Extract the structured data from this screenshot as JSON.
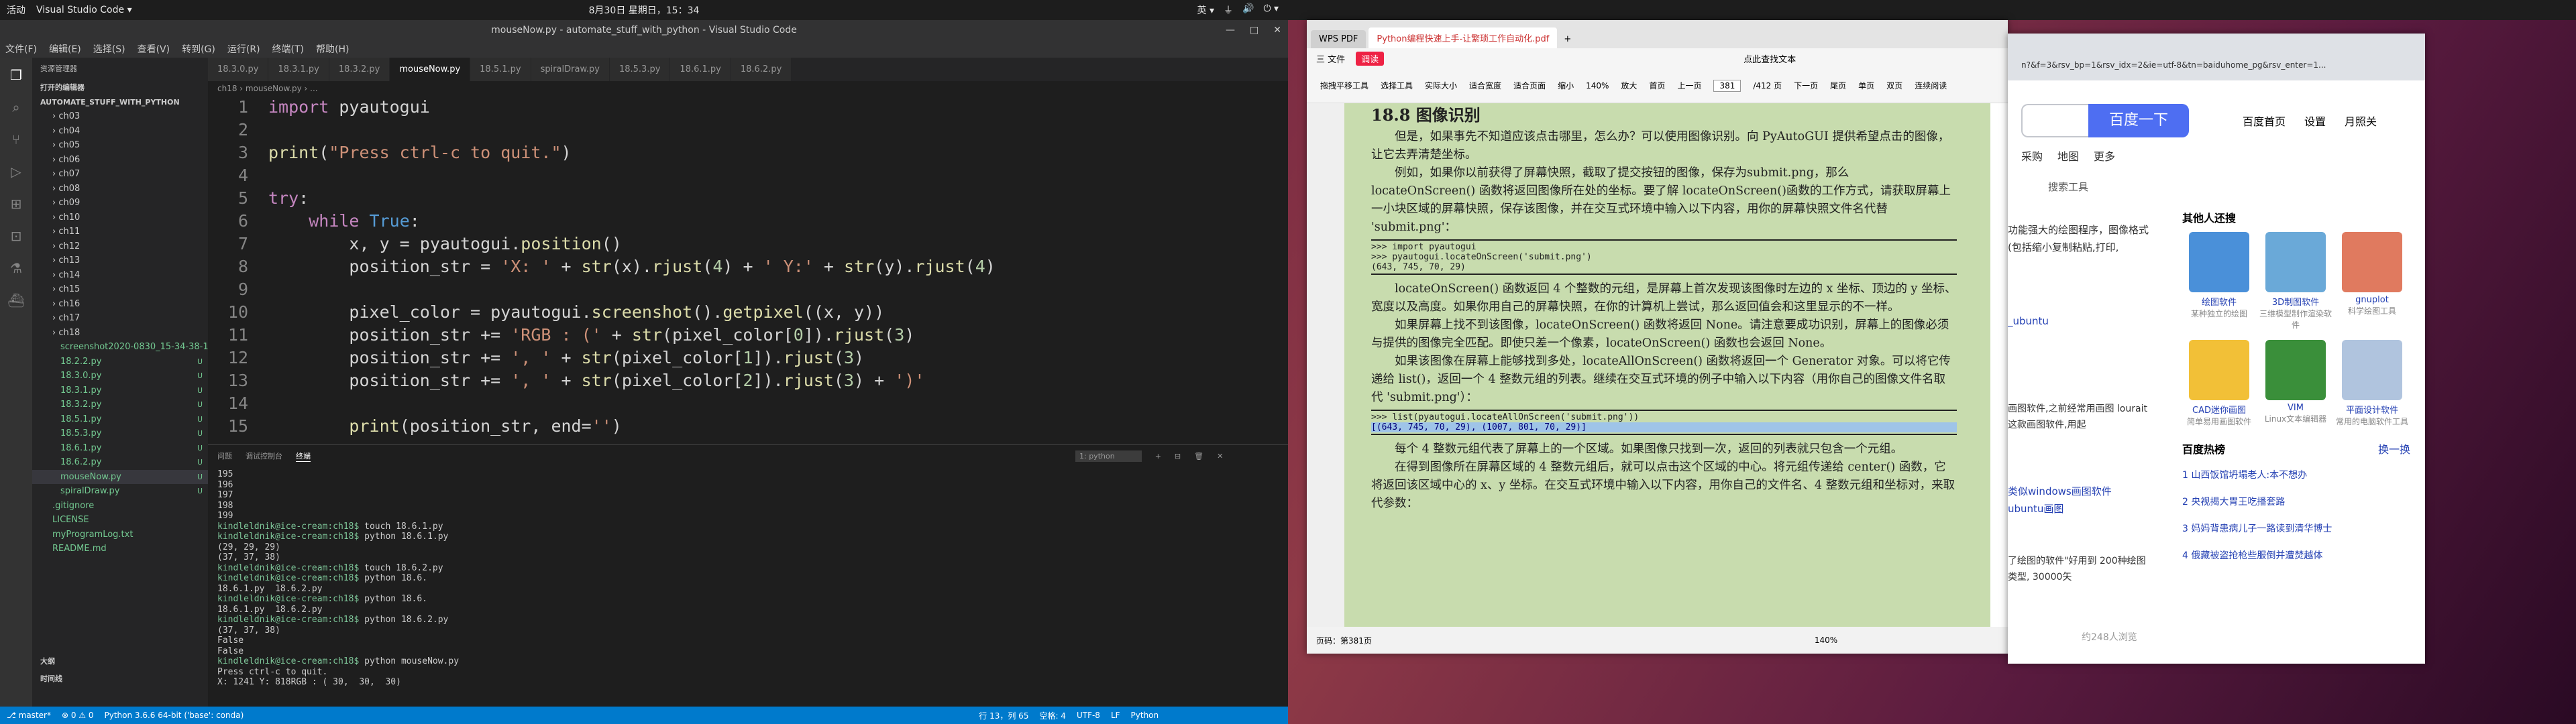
{
  "topbar": {
    "activities": "活动",
    "app": "Visual Studio Code ▾",
    "clock": "8月30日 星期日，15：34",
    "lang": "英 ▾"
  },
  "vscode": {
    "title": "mouseNow.py - automate_stuff_with_python - Visual Studio Code",
    "menu": [
      "文件(F)",
      "编辑(E)",
      "选择(S)",
      "查看(V)",
      "转到(G)",
      "运行(R)",
      "终端(T)",
      "帮助(H)"
    ],
    "side_header": "资源管理器",
    "open_editors": "打开的编辑器",
    "project": "AUTOMATE_STUFF_WITH_PYTHON",
    "tree": [
      "ch03",
      "ch04",
      "ch05",
      "ch06",
      "ch07",
      "ch08",
      "ch09",
      "ch10",
      "ch11",
      "ch12",
      "ch13",
      "ch14",
      "ch15",
      "ch16",
      "ch17",
      "ch18"
    ],
    "files": [
      {
        "name": "screenshot2020-0830_15-34-38-1...",
        "badge": "U"
      },
      {
        "name": "18.2.2.py",
        "badge": "U"
      },
      {
        "name": "18.3.0.py",
        "badge": "U"
      },
      {
        "name": "18.3.1.py",
        "badge": "U"
      },
      {
        "name": "18.3.2.py",
        "badge": "U"
      },
      {
        "name": "18.5.1.py",
        "badge": "U"
      },
      {
        "name": "18.5.3.py",
        "badge": "U"
      },
      {
        "name": "18.6.1.py",
        "badge": "U"
      },
      {
        "name": "18.6.2.py",
        "badge": "U"
      },
      {
        "name": "mouseNow.py",
        "badge": "U"
      },
      {
        "name": "spiralDraw.py",
        "badge": "U"
      },
      {
        "name": ".gitignore",
        "badge": ""
      },
      {
        "name": "LICENSE",
        "badge": ""
      },
      {
        "name": "myProgramLog.txt",
        "badge": ""
      },
      {
        "name": "README.md",
        "badge": ""
      }
    ],
    "outline": "大纲",
    "timeline": "时间线",
    "tabs": [
      "18.3.0.py",
      "18.3.1.py",
      "18.3.2.py",
      "mouseNow.py",
      "18.5.1.py",
      "spiralDraw.py",
      "18.5.3.py",
      "18.6.1.py",
      "18.6.2.py"
    ],
    "breadcrumb": "ch18 › mouseNow.py › ...",
    "code": [
      "import pyautogui",
      "",
      "print(\"Press ctrl-c to quit.\")",
      "",
      "try:",
      "    while True:",
      "        x, y = pyautogui.position()",
      "        position_str = 'X: ' + str(x).rjust(4) + ' Y:' + str(y).rjust(4)",
      "",
      "        pixel_color = pyautogui.screenshot().getpixel((x, y))",
      "        position_str += 'RGB : (' + str(pixel_color[0]).rjust(3)",
      "        position_str += ', ' + str(pixel_color[1]).rjust(3)",
      "        position_str += ', ' + str(pixel_color[2]).rjust(3) + ')'",
      "",
      "        print(position_str, end='')"
    ],
    "panel_tabs": [
      "问题",
      "调试控制台",
      "终端"
    ],
    "terminal_select": "1: python",
    "terminal": [
      "195",
      "196",
      "197",
      "198",
      "199",
      "kindleldnik@ice-cream:ch18$ touch 18.6.1.py",
      "kindleldnik@ice-cream:ch18$ python 18.6.1.py",
      "(29, 29, 29)",
      "(37, 37, 38)",
      "kindleldnik@ice-cream:ch18$ touch 18.6.2.py",
      "kindleldnik@ice-cream:ch18$ python 18.6.",
      "18.6.1.py  18.6.2.py",
      "kindleldnik@ice-cream:ch18$ python 18.6.",
      "18.6.1.py  18.6.2.py",
      "kindleldnik@ice-cream:ch18$ python 18.6.2.py",
      "(37, 37, 38)",
      "False",
      "False",
      "kindleldnik@ice-cream:ch18$ python mouseNow.py",
      "Press ctrl-c to quit.",
      "X: 1241 Y: 818RGB : ( 30,  30,  30)"
    ],
    "status": [
      "⎇ master*",
      "⊗ 0 ⚠ 0",
      "Python 3.6.6 64-bit ('base': conda)",
      "行 13，列 65",
      "空格: 4",
      "UTF-8",
      "LF",
      "Python"
    ]
  },
  "wps": {
    "tabs": [
      "WPS PDF",
      "Python编程快速上手-让繁琐工作自动化.pdf"
    ],
    "menu": [
      "三 文件",
      "调读",
      "点此查找文本"
    ],
    "tools": [
      "拖拽平移工具",
      "选择工具",
      "实际大小",
      "适合宽度",
      "适合页面",
      "缩小",
      "140%",
      "放大",
      "首页",
      "上一页",
      "381",
      "/412 页",
      "下一页",
      "尾页",
      "单页",
      "双页",
      "连续阅读"
    ],
    "heading": "18.8   图像识别",
    "para1": "但是，如果事先不知道应该点击哪里，怎么办？可以使用图像识别。向 PyAutoGUI 提供希望点击的图像，让它去弄清楚坐标。",
    "para2": "例如，如果你以前获得了屏幕快照，截取了提交按钮的图像，保存为submit.png，那么 locateOnScreen() 函数将返回图像所在处的坐标。要了解 locateOnScreen()函数的工作方式，请获取屏幕上一小块区域的屏幕快照，保存该图像，并在交互式环境中输入以下内容，用你的屏幕快照文件名代替 'submit.png'：",
    "code1": [
      ">>> import pyautogui",
      ">>> pyautogui.locateOnScreen('submit.png')",
      "(643, 745, 70, 29)"
    ],
    "para3": "locateOnScreen() 函数返回 4 个整数的元组，是屏幕上首次发现该图像时左边的 x 坐标、顶边的 y 坐标、宽度以及高度。如果你用自己的屏幕快照，在你的计算机上尝试，那么返回值会和这里显示的不一样。",
    "para4": "如果屏幕上找不到该图像，locateOnScreen() 函数将返回 None。请注意要成功识别，屏幕上的图像必须与提供的图像完全匹配。即使只差一个像素，locateOnScreen() 函数也会返回 None。",
    "para5": "如果该图像在屏幕上能够找到多处，locateAllOnScreen() 函数将返回一个 Generator 对象。可以将它传递给 list()，返回一个 4 整数元组的列表。继续在交互式环境的例子中输入以下内容（用你自己的图像文件名取代 'submit.png'）：",
    "code2": [
      ">>> list(pyautogui.locateAllOnScreen('submit.png'))",
      "[(643, 745, 70, 29), (1007, 801, 70, 29)]"
    ],
    "para6": "每个 4 整数元组代表了屏幕上的一个区域。如果图像只找到一次，返回的列表就只包含一个元组。",
    "para7": "在得到图像所在屏幕区域的 4 整数元组后，就可以点击这个区域的中心。将元组传递给 center() 函数，它将返回该区域中心的 x、y 坐标。在交互式环境中输入以下内容，用你自己的文件名、4 整数元组和坐标对，来取代参数：",
    "status_left": "页码：第381页",
    "zoom": "140%"
  },
  "browser": {
    "url": "n?&f=3&rsv_bp=1&rsv_idx=2&ie=utf-8&tn=baiduhome_pg&rsv_enter=1...",
    "search_btn": "百度一下",
    "nav": [
      "百度首页",
      "设置",
      "月照关"
    ],
    "tabs_row": [
      "采购",
      "地图",
      "更多"
    ],
    "tools": "搜索工具",
    "snippet1": "功能强大的绘图程序，图像格式(包括缩小复制粘贴,打印,",
    "snippet_link": "_ubuntu",
    "snippet2": "画图软件,之前经常用画图 lourait这款画图软件,用起",
    "snippet3": "类似windows画图软件 ubuntu画图",
    "snippet4": "了绘图的软件\"好用到 200种绘图类型, 30000矢",
    "count": "约248人浏览",
    "others_title": "其他人还搜",
    "apps": [
      "绘图软件",
      "3D制图软件",
      "gnuplot",
      "CAD迷你画图",
      "VIM",
      "平面设计软件"
    ],
    "apps_sub": [
      "某种独立的绘图",
      "三维模型制作渲染软件",
      "科学绘图工具",
      "简单易用画图软件",
      "Linux文本编辑器",
      "常用的电脑软件工具"
    ],
    "hot_title": "百度热榜",
    "hot_refresh": "换一换",
    "hot": [
      "山西饭馆坍塌老人:本不想办",
      "央视揭大胃王吃播套路",
      "妈妈背患病儿子一路读到清华博士",
      "俄藏被盗抢枪些服倒并遭焚越体"
    ]
  }
}
